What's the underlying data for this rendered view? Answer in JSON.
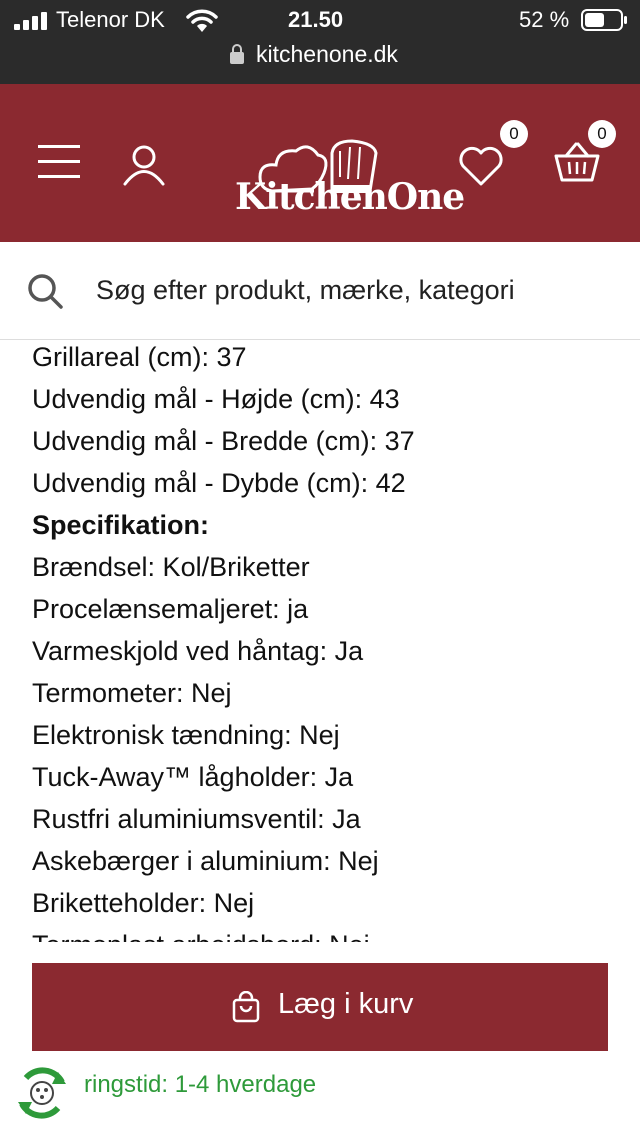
{
  "status_bar": {
    "carrier": "Telenor DK",
    "time": "21.50",
    "battery": "52 %",
    "url": "kitchenone.dk"
  },
  "header": {
    "logo_text": "KitchenOne",
    "wishlist_count": "0",
    "cart_count": "0",
    "brand_color": "#8b2930"
  },
  "search": {
    "placeholder": "Søg efter produkt, mærke, kategori"
  },
  "specs": {
    "lines": [
      "Grillareal (cm): 37",
      "Udvendig mål - Højde (cm): 43",
      "Udvendig mål - Bredde (cm): 37",
      "Udvendig mål - Dybde (cm): 42"
    ],
    "heading": "Specifikation:",
    "items": [
      "Brændsel: Kol/Briketter",
      "Procelænsemaljeret: ja",
      "Varmeskjold ved håntag: Ja",
      "Termometer: Nej",
      "Elektronisk tændning: Nej",
      "Tuck-Away™ lågholder: Ja",
      "Rustfri aluminiumsventil: Ja",
      "Askebærger i aluminium: Nej",
      "Briketteholder: Nej",
      "Termoplast arbeidsbord: Nej"
    ]
  },
  "actions": {
    "add_to_cart": "Læg i kurv"
  },
  "delivery": {
    "text": "ringstid: 1-4 hverdage",
    "color": "#2e9a3a"
  },
  "icons": [
    "signal-icon",
    "wifi-icon",
    "battery-icon",
    "lock-icon",
    "menu-icon",
    "account-icon",
    "chef-hat-icon",
    "heart-icon",
    "basket-icon",
    "search-icon",
    "bag-icon",
    "delivery-icon"
  ]
}
